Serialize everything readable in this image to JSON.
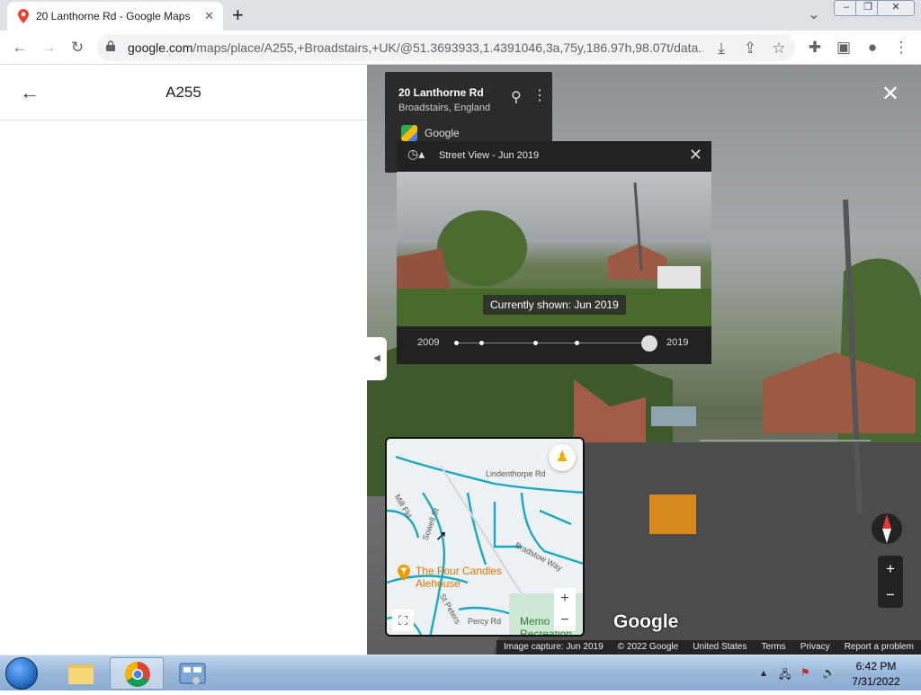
{
  "browser": {
    "tab_title": "20 Lanthorne Rd - Google Maps",
    "new_tab": "+",
    "url_host": "google.com",
    "url_rest": "/maps/place/A255,+Broadstairs,+UK/@51.3693933,1.4391046,3a,75y,186.97h,98.07t/data..."
  },
  "left_panel": {
    "title": "A255",
    "back": "←"
  },
  "street_view": {
    "info_card": {
      "title": "20 Lanthorne Rd",
      "subtitle": "Broadstairs, England",
      "source": "Google"
    },
    "timeline": {
      "title": "Street View - Jun 2019",
      "current_label": "Currently shown: Jun 2019",
      "start_year": "2009",
      "end_year": "2019",
      "stops": 6,
      "selected_stop": 6
    },
    "minimap": {
      "street_labels": [
        "Lindenthorpe Rd",
        "Mill Fld",
        "Sowell St",
        "Bradstow Way",
        "Percy Rd",
        "St Peters"
      ],
      "poi_name": "The Four Candles Alehouse",
      "park_label": "Memo Recreation"
    },
    "logo": "Google",
    "attribution": [
      "Image capture: Jun 2019",
      "© 2022 Google",
      "United States",
      "Terms",
      "Privacy",
      "Report a problem"
    ],
    "close": "✕"
  },
  "taskbar": {
    "time": "6:42 PM",
    "date": "7/31/2022"
  }
}
